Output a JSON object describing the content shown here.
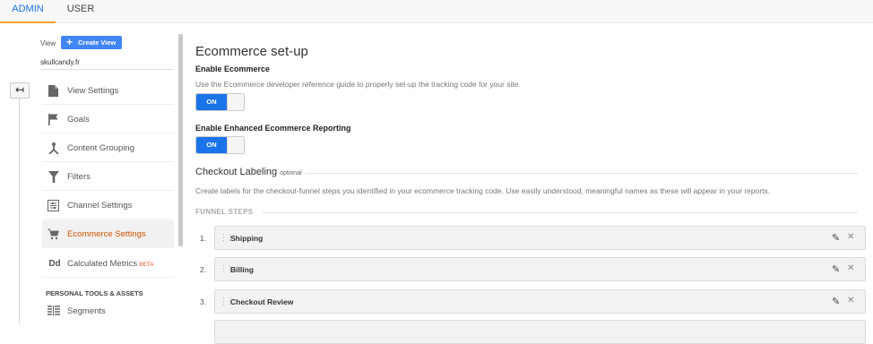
{
  "tabs": {
    "admin": "ADMIN",
    "user": "USER"
  },
  "view": {
    "label": "View",
    "create_button": "Create View",
    "name": "skullcandy.fr"
  },
  "sidebar": {
    "items": [
      {
        "label": "View Settings",
        "icon": "document-icon"
      },
      {
        "label": "Goals",
        "icon": "flag-icon"
      },
      {
        "label": "Content Grouping",
        "icon": "grouping-icon"
      },
      {
        "label": "Filters",
        "icon": "filter-icon"
      },
      {
        "label": "Channel Settings",
        "icon": "channel-icon"
      },
      {
        "label": "Ecommerce Settings",
        "icon": "cart-icon",
        "active": true
      },
      {
        "label": "Calculated Metrics",
        "icon": "dd-icon",
        "badge": "BETA"
      }
    ],
    "section_heading": "PERSONAL TOOLS & ASSETS",
    "segments_label": "Segments"
  },
  "main": {
    "title": "Ecommerce set-up",
    "enable_ecommerce": {
      "label": "Enable Ecommerce",
      "description": "Use the Ecommerce developer reference guide to properly set-up the tracking code for your site.",
      "toggle": "ON"
    },
    "enhanced": {
      "label": "Enable Enhanced Ecommerce Reporting",
      "toggle": "ON"
    },
    "checkout": {
      "title": "Checkout Labeling",
      "optional": "optional",
      "description": "Create labels for the checkout-funnel steps you identified in your ecommerce tracking code. Use easily understood, meaningful names as these will appear in your reports."
    },
    "funnel_heading": "FUNNEL STEPS",
    "steps": [
      {
        "num": "1.",
        "name": "Shipping"
      },
      {
        "num": "2.",
        "name": "Billing"
      },
      {
        "num": "3.",
        "name": "Checkout Review"
      }
    ]
  },
  "colors": {
    "accent": "#1a73e8",
    "active_nav": "#d35400",
    "tab_underline": "#f4a233",
    "beta": "#e8542a"
  }
}
